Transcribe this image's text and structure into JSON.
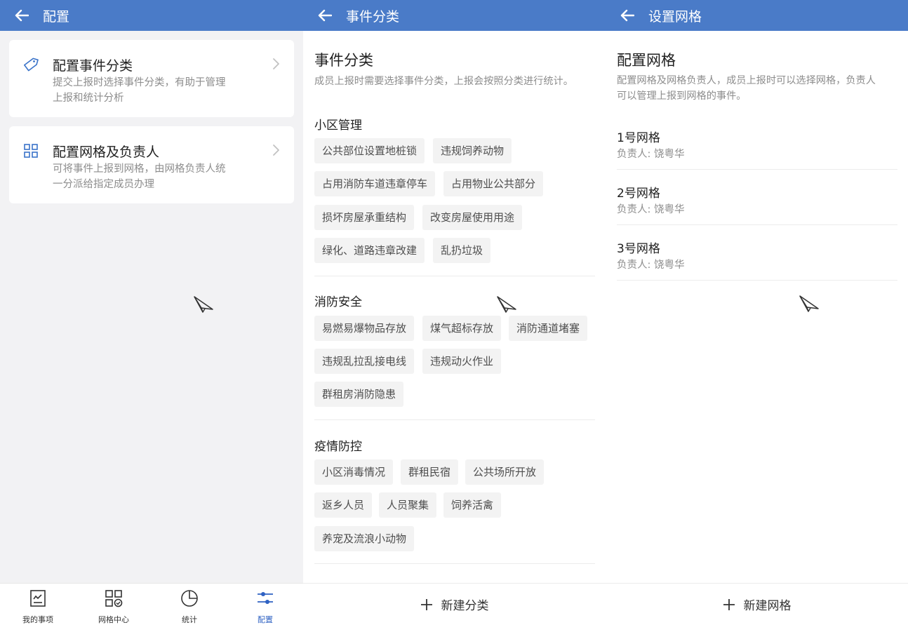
{
  "panel1": {
    "title": "配置",
    "cards": [
      {
        "title": "配置事件分类",
        "desc_line1": "提交上报时选择事件分类，有助于管理",
        "desc_line2": "上报和统计分析",
        "icon": "tag-icon"
      },
      {
        "title": "配置网格及负责人",
        "desc_line1": "可将事件上报到网格，由网格负责人统",
        "desc_line2": "一分派给指定成员办理",
        "icon": "grid-icon"
      }
    ],
    "nav": [
      {
        "label": "我的事项",
        "icon": "todo-list-icon"
      },
      {
        "label": "网格中心",
        "icon": "grid-center-icon"
      },
      {
        "label": "统计",
        "icon": "pie-chart-icon"
      },
      {
        "label": "配置",
        "icon": "sliders-icon",
        "active": true
      }
    ]
  },
  "panel2": {
    "title": "事件分类",
    "heading": "事件分类",
    "desc": "成员上报时需要选择事件分类，上报会按照分类进行统计。",
    "groups": [
      {
        "name": "小区管理",
        "items": [
          "公共部位设置地桩锁",
          "违规饲养动物",
          "占用消防车道违章停车",
          "占用物业公共部分",
          "损坏房屋承重结构",
          "改变房屋使用用途",
          "绿化、道路违章改建",
          "乱扔垃圾"
        ]
      },
      {
        "name": "消防安全",
        "items": [
          "易燃易爆物品存放",
          "煤气超标存放",
          "消防通道堵塞",
          "违规乱拉乱接电线",
          "违规动火作业",
          "群租房消防隐患"
        ]
      },
      {
        "name": "疫情防控",
        "items": [
          "小区消毒情况",
          "群租民宿",
          "公共场所开放",
          "返乡人员",
          "人员聚集",
          "饲养活禽",
          "养宠及流浪小动物"
        ]
      }
    ],
    "add_label": "新建分类"
  },
  "panel3": {
    "title": "设置网格",
    "heading": "配置网格",
    "desc_line1": "配置网格及网格负责人，成员上报时可以选择网格，负责人",
    "desc_line2": "可以管理上报到网格的事件。",
    "grids": [
      {
        "name": "1号网格",
        "owner": "负责人: 饶粤华"
      },
      {
        "name": "2号网格",
        "owner": "负责人: 饶粤华"
      },
      {
        "name": "3号网格",
        "owner": "负责人: 饶粤华"
      }
    ],
    "add_label": "新建网格"
  },
  "colors": {
    "appbar": "#4a7bc8",
    "accent": "#2f62c3"
  }
}
